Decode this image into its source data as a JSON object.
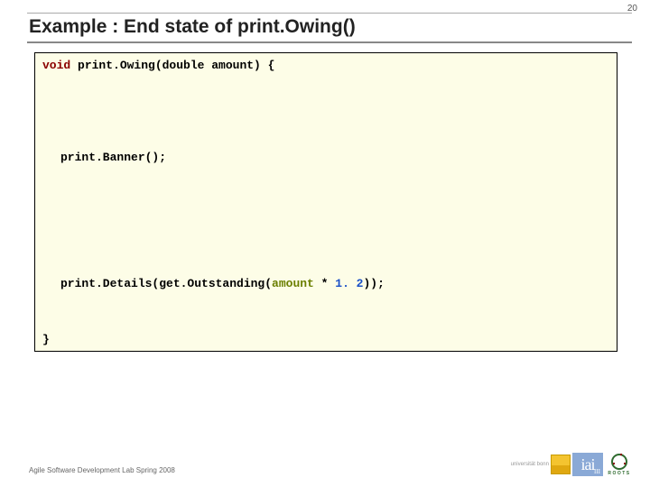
{
  "pageNumber": "20",
  "title": "Example : End state of print.Owing()",
  "code": {
    "line1": {
      "keyword": "void",
      "rest": " print.Owing(double amount) {"
    },
    "line2": "print.Banner();",
    "line3": {
      "before": "print.Details(get.Outstanding(",
      "param": "amount",
      "op": " *",
      "num": " 1. 2",
      "after": "));"
    },
    "line4": "}"
  },
  "footer": "Agile Software Development Lab Spring 2008",
  "logos": {
    "roots": "ROOTS",
    "bonn_alt": "universität bonn"
  }
}
